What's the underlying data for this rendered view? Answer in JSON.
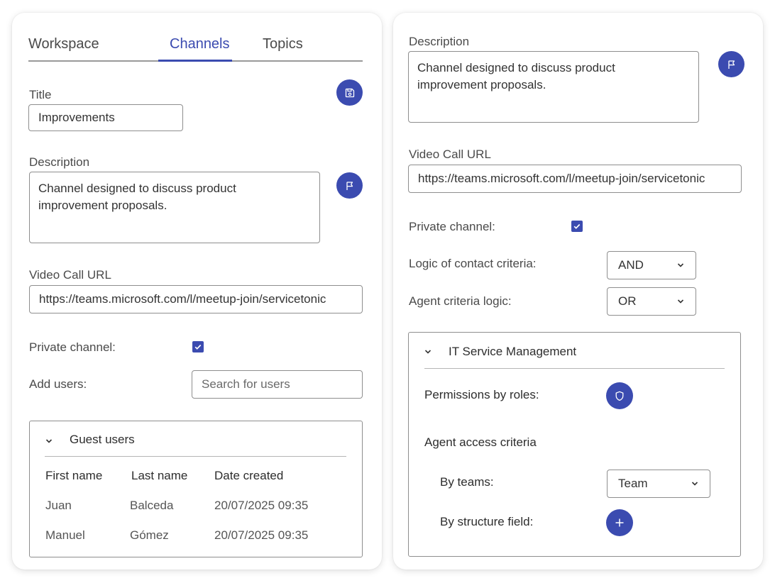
{
  "left": {
    "tabs": [
      {
        "label": "Workspace"
      },
      {
        "label": "Channels"
      },
      {
        "label": "Topics"
      }
    ],
    "title_label": "Title",
    "title_value": "Improvements",
    "description_label": "Description",
    "description_value": "Channel designed to discuss product\nimprovement proposals.",
    "video_url_label": "Video Call URL",
    "video_url_value": "https://teams.microsoft.com/l/meetup-join/servicetonic",
    "private_channel_label": "Private channel:",
    "add_users_label": "Add users:",
    "search_placeholder": "Search for users",
    "guest_panel": {
      "title": "Guest users",
      "columns": [
        "First name",
        "Last name",
        "Date created"
      ],
      "rows": [
        [
          "Juan",
          "Balceda",
          "20/07/2025 09:35"
        ],
        [
          "Manuel",
          "Gómez",
          "20/07/2025 09:35"
        ]
      ]
    }
  },
  "right": {
    "description_label": "Description",
    "description_value": "Channel designed to discuss product\nimprovement proposals.",
    "video_url_label": "Video Call URL",
    "video_url_value": "https://teams.microsoft.com/l/meetup-join/servicetonic",
    "private_channel_label": "Private channel:",
    "contact_logic_label": "Logic of contact criteria:",
    "contact_logic_value": "AND",
    "agent_logic_label": "Agent criteria logic:",
    "agent_logic_value": "OR",
    "itsm_panel": {
      "title": "IT Service Management",
      "permissions_label": "Permissions by roles:",
      "agent_access_label": "Agent access criteria",
      "by_teams_label": "By teams:",
      "by_teams_value": "Team",
      "by_structure_label": "By structure field:"
    }
  },
  "colors": {
    "accent": "#3b4bb0",
    "border": "#8e8e8e",
    "text": "#3a3a3a"
  },
  "icons": {
    "save": "floppy-disk",
    "flag": "flag",
    "shield": "shield",
    "add": "plus",
    "chevron": "chevron-down",
    "check": "checkmark"
  }
}
